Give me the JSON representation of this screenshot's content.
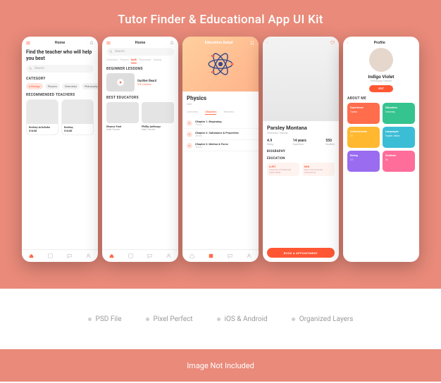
{
  "title": "Tutor Finder & Educational App UI Kit",
  "features": [
    "PSD File",
    "Pixel Perfect",
    "iOS & Android",
    "Organized Layers"
  ],
  "footnote": "Image Not Included",
  "screen1": {
    "header": "Home",
    "hero": "Find the teacher who will help you best",
    "search_placeholder": "Search",
    "category_label": "CATEGORY",
    "categories": [
      {
        "label": "Biology",
        "active": true
      },
      {
        "label": "Physics",
        "active": false
      },
      {
        "label": "Chemistry",
        "active": false
      },
      {
        "label": "Philosophy",
        "active": false
      }
    ],
    "recommended_label": "RECOMMENDED TEACHERS",
    "teachers": [
      {
        "name": "Rodney Artichoke",
        "price": "$14.00"
      },
      {
        "name": "Rodney",
        "price": "$14.00"
      }
    ]
  },
  "screen2": {
    "header": "Home",
    "search_placeholder": "Search",
    "subjects": [
      "Chemistry",
      "Physics",
      "Math",
      "Philosophy",
      "Coding"
    ],
    "active_subject": 2,
    "beginner_label": "BEGINNER LESSONS",
    "lesson": {
      "author": "Gunther Beard",
      "meta": "",
      "cta": "576 Lessons"
    },
    "best_label": "BEST EDUCATORS",
    "educators": [
      {
        "name": "Eleanor Fant",
        "role": "Math Teacher"
      },
      {
        "name": "Phillip Anthropy",
        "role": "Math Teacher"
      }
    ]
  },
  "screen3": {
    "header": "Education Detail",
    "title": "Physics",
    "subtitle": "24m",
    "tabs": [
      "Overview",
      "Chapters",
      "Reviews"
    ],
    "active_tab": 1,
    "chapters": [
      {
        "title": "Chapter 1: Beginning",
        "meta": "10 min"
      },
      {
        "title": "Chapter 2: Substance & Properties",
        "meta": "28 min"
      },
      {
        "title": "Chapter 3: Motion & Force",
        "meta": "18 min"
      }
    ]
  },
  "screen4": {
    "name": "Parsley Montana",
    "role": "Chemistry Teacher",
    "stats": [
      {
        "value": "4.9",
        "label": "Rating"
      },
      {
        "value": "14 years",
        "label": "Experience"
      },
      {
        "value": "550",
        "label": "Students"
      }
    ],
    "bio_label": "BIOGRAPHY",
    "edu_label": "EDUCATION",
    "unis": [
      {
        "name": "U.PIT",
        "detail": "University of Pittsburgh",
        "years": "(2001-2005)"
      },
      {
        "name": "NYU",
        "detail": "New York University",
        "years": "(2010-2014)"
      }
    ],
    "cta": "BOOK A APPOINTMENT"
  },
  "screen5": {
    "header": "Profile",
    "name": "Indigo Violet",
    "role": "Philosophy Teacher",
    "edit": "EDIT",
    "about_label": "ABOUT ME",
    "cards": [
      {
        "label": "Experience",
        "value": "5 years",
        "color": "#ff6d4d"
      },
      {
        "label": "Education",
        "value": "University",
        "color": "#35c38f"
      },
      {
        "label": "Achievements",
        "value": "10",
        "color": "#ffb830"
      },
      {
        "label": "Languages",
        "value": "English, Italian",
        "color": "#3bbdd6"
      },
      {
        "label": "Rating",
        "value": "4.7",
        "color": "#9a6cf0"
      },
      {
        "label": "Students",
        "value": "56",
        "color": "#ff6d9a"
      }
    ]
  }
}
